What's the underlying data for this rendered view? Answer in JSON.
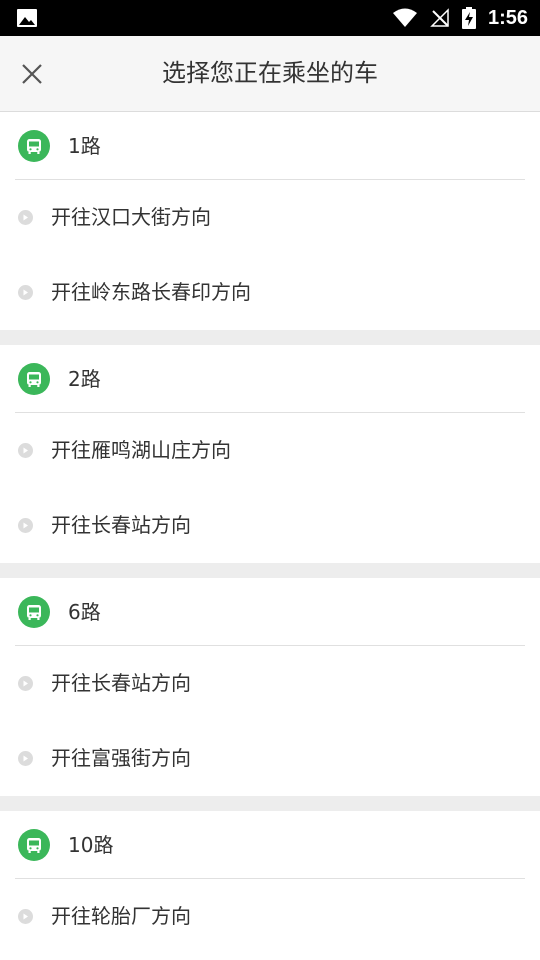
{
  "status_bar": {
    "time": "1:56",
    "icons": [
      "image-icon",
      "wifi-icon",
      "no-signal-icon",
      "battery-charging-icon"
    ]
  },
  "header": {
    "title": "选择您正在乘坐的车",
    "close_icon": "close-icon"
  },
  "colors": {
    "accent_green": "#3bb75a",
    "header_bg": "#f6f6f6",
    "separator_bg": "#ededed",
    "text": "#333333"
  },
  "routes": [
    {
      "name": "1路",
      "directions": [
        "开往汉口大街方向",
        "开往岭东路长春印方向"
      ]
    },
    {
      "name": "2路",
      "directions": [
        "开往雁鸣湖山庄方向",
        "开往长春站方向"
      ]
    },
    {
      "name": "6路",
      "directions": [
        "开往长春站方向",
        "开往富强街方向"
      ]
    },
    {
      "name": "10路",
      "directions": [
        "开往轮胎厂方向"
      ]
    }
  ]
}
